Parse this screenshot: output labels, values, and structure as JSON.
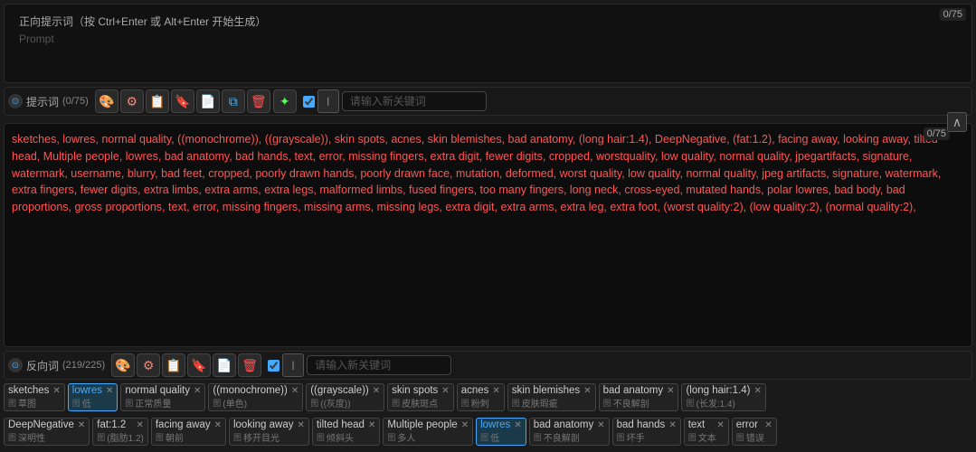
{
  "positive_prompt": {
    "label": "正向提示词（按 Ctrl+Enter 或 Alt+Enter 开始生成）",
    "placeholder": "Prompt",
    "counter": "0/75"
  },
  "positive_toolbar": {
    "label": "提示词",
    "badge": "(0/75)",
    "buttons": [
      {
        "id": "style1",
        "icon": "🎨",
        "class": "orange",
        "title": "style"
      },
      {
        "id": "style2",
        "icon": "⚙",
        "class": "orange",
        "title": "settings"
      },
      {
        "id": "copy1",
        "icon": "📋",
        "class": "cyan",
        "title": "copy"
      },
      {
        "id": "bookmark",
        "icon": "🔖",
        "class": "cyan",
        "title": "bookmark"
      },
      {
        "id": "paste",
        "icon": "📄",
        "class": "cyan",
        "title": "paste"
      },
      {
        "id": "duplicate",
        "icon": "⧉",
        "class": "cyan",
        "title": "duplicate"
      },
      {
        "id": "delete",
        "icon": "🗑",
        "class": "red",
        "title": "delete"
      },
      {
        "id": "ai",
        "icon": "✨",
        "class": "green",
        "title": "ai"
      }
    ],
    "keyword_placeholder": "请输入新关键词"
  },
  "negative_counter": "0/75",
  "negative_content": "sketches, lowres, normal quality, ((monochrome)), ((grayscale)), skin spots, acnes, skin blemishes, bad anatomy, (long hair:1.4), DeepNegative, (fat:1.2), facing away, looking away, tilted head, Multiple people, lowres, bad anatomy, bad hands, text, error, missing fingers, extra digit, fewer digits, cropped, worstquality, low quality, normal quality, jpegartifacts, signature, watermark, username, blurry, bad feet, cropped, poorly drawn hands, poorly drawn face, mutation, deformed, worst quality, low quality, normal quality, jpeg artifacts, signature, watermark, extra fingers, fewer digits, extra limbs, extra arms, extra legs, malformed limbs, fused fingers, too many fingers, long neck, cross-eyed, mutated hands, polar lowres, bad body, bad proportions, gross proportions, text, error, missing fingers, missing arms, missing legs, extra digit, extra arms, extra leg, extra foot, (worst quality:2), (low quality:2), (normal quality:2),",
  "negative_toolbar": {
    "label": "反向词",
    "badge": "(219/225)",
    "keyword_placeholder": "请输入新关键词"
  },
  "tags_row1": [
    {
      "name": "sketches",
      "icon": "图",
      "subtitle": "草图",
      "highlighted": false
    },
    {
      "name": "lowres",
      "icon": "低",
      "subtitle": "低",
      "highlighted": true
    },
    {
      "name": "normal quality",
      "icon": "正",
      "subtitle": "正常质量",
      "highlighted": false
    },
    {
      "name": "((monochrome))",
      "icon": "单",
      "subtitle": "(单色)",
      "highlighted": false
    },
    {
      "name": "((grayscale))",
      "icon": "灰",
      "subtitle": "((灰度))",
      "highlighted": false
    },
    {
      "name": "skin spots",
      "icon": "皮",
      "subtitle": "皮肤斑点",
      "highlighted": false
    },
    {
      "name": "acnes",
      "icon": "粉",
      "subtitle": "粉刺",
      "highlighted": false
    },
    {
      "name": "skin blemishes",
      "icon": "皮",
      "subtitle": "皮肤瑕疵",
      "highlighted": false
    },
    {
      "name": "bad anatomy",
      "icon": "不",
      "subtitle": "不良解剖",
      "highlighted": false
    },
    {
      "name": "(long hair:1.4)",
      "icon": "长",
      "subtitle": "(长发:1.4)",
      "highlighted": false
    }
  ],
  "tags_row2": [
    {
      "name": "DeepNegative",
      "icon": "深",
      "subtitle": "深明性",
      "highlighted": false
    },
    {
      "name": "fat:1.2",
      "icon": "脂",
      "subtitle": "(脂肪1.2)",
      "highlighted": false
    },
    {
      "name": "facing away",
      "icon": "朝",
      "subtitle": "朝前",
      "highlighted": false
    },
    {
      "name": "looking away",
      "icon": "移",
      "subtitle": "移开目光",
      "highlighted": false
    },
    {
      "name": "tilted head",
      "icon": "倾",
      "subtitle": "倾斜头",
      "highlighted": false
    },
    {
      "name": "Multiple people",
      "icon": "多",
      "subtitle": "多人",
      "highlighted": false
    },
    {
      "name": "lowres",
      "icon": "低",
      "subtitle": "低",
      "highlighted": true
    },
    {
      "name": "bad anatomy",
      "icon": "不",
      "subtitle": "不良解剖",
      "highlighted": false
    },
    {
      "name": "bad hands",
      "icon": "坏",
      "subtitle": "坏手",
      "highlighted": false
    },
    {
      "name": "text",
      "icon": "文",
      "subtitle": "文本",
      "highlighted": false
    },
    {
      "name": "error",
      "icon": "错",
      "subtitle": "错误",
      "highlighted": false
    }
  ]
}
